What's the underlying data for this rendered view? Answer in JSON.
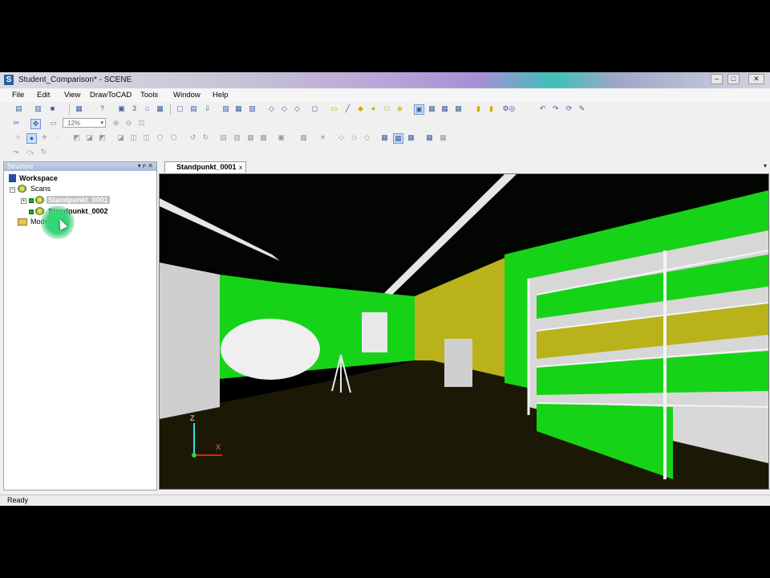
{
  "window": {
    "title": "Student_Comparison* - SCENE",
    "app_icon_letter": "S",
    "controls": {
      "minimize": "–",
      "maximize": "□",
      "close": "✕"
    }
  },
  "menubar": [
    "File",
    "Edit",
    "View",
    "DrawToCAD",
    "Tools",
    "Window",
    "Help"
  ],
  "toolbar": {
    "zoom_value": "12%"
  },
  "structure": {
    "title": "Structure",
    "header_buttons": "▾ ᴘ ✕",
    "workspace": "Workspace",
    "scans_folder": "Scans",
    "scans": [
      {
        "label": "Standpunkt_0001",
        "selected": true
      },
      {
        "label": "Standpunkt_0002",
        "selected": false
      }
    ],
    "models_folder": "Models"
  },
  "document": {
    "tab_label": "Standpunkt_0001",
    "tab_close": "x",
    "overflow": "▾"
  },
  "axis_gizmo": {
    "z": "Z",
    "x": "X"
  },
  "status": {
    "text": "Ready"
  },
  "colors": {
    "wall_green": "#17d317",
    "shelf_yellow": "#b9b21a",
    "floor": "#1c1a07",
    "ceiling": "#040604",
    "selection_gray": "#c0c0c0"
  }
}
